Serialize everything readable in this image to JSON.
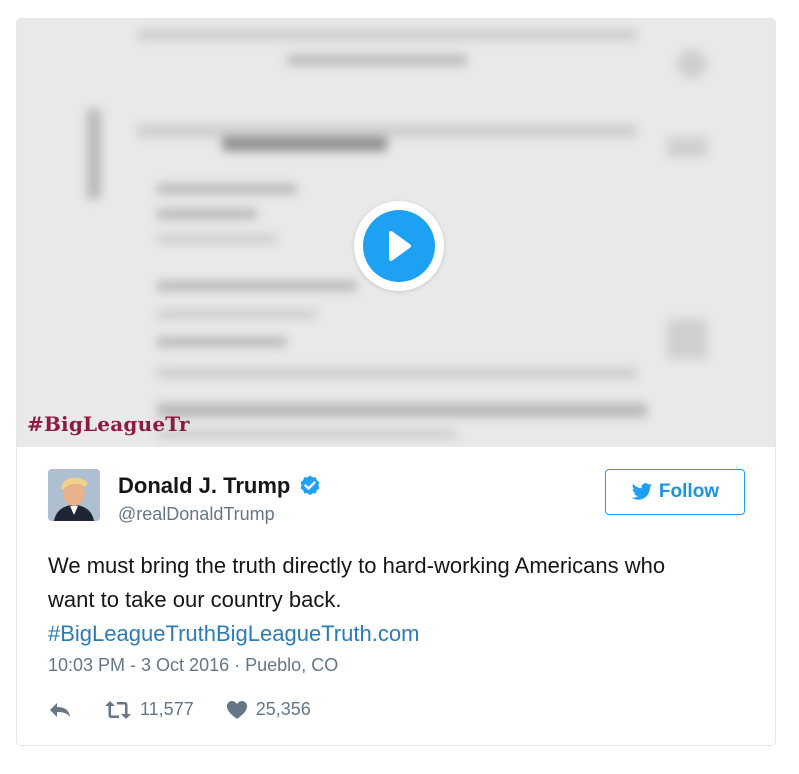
{
  "video": {
    "overlay_hashtag": "#BigLeagueTr"
  },
  "tweet": {
    "author_name": "Donald J. Trump",
    "author_handle": "@realDonaldTrump",
    "follow_label": "Follow",
    "text_line1": "We must bring the truth directly to hard-working Americans who",
    "text_line2": "want to take our country back.",
    "link_text": "#BigLeagueTruthBigLeagueTruth.com",
    "time": "10:03 PM - 3 Oct 2016",
    "separator": "·",
    "location": "Pueblo, CO",
    "retweet_count": "11,577",
    "like_count": "25,356"
  },
  "colors": {
    "accent": "#1da1f2",
    "link": "#2b7bb9",
    "muted": "#657786",
    "overlay_text": "#8e1b3d"
  },
  "icons": {
    "play": "play-icon",
    "verified": "verified-badge-icon",
    "bird": "twitter-bird-icon",
    "reply": "reply-icon",
    "retweet": "retweet-icon",
    "like": "heart-icon"
  }
}
